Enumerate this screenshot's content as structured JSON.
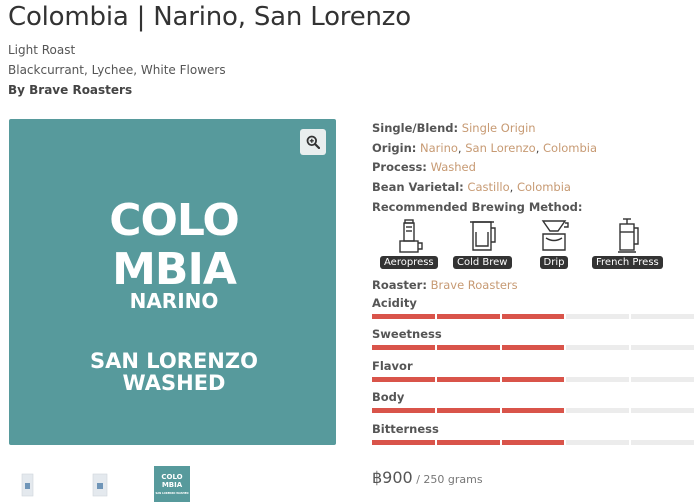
{
  "product": {
    "title": "Colombia | Narino, San Lorenzo",
    "roast": "Light Roast",
    "notes": "Blackcurrant, Lychee, White Flowers",
    "by": "By Brave Roasters"
  },
  "image": {
    "bag_lines": [
      "COLO",
      "MBIA",
      "NARINO",
      "SAN LORENZO",
      "WASHED"
    ],
    "thumb_lines": [
      "COLO",
      "MBIA",
      "SAN LORENZO WASHED"
    ]
  },
  "details": {
    "single_blend": {
      "label": "Single/Blend:",
      "value": "Single Origin"
    },
    "origin": {
      "label": "Origin:",
      "values": [
        "Narino",
        "San Lorenzo",
        "Colombia"
      ],
      "sep": ", "
    },
    "process": {
      "label": "Process:",
      "value": "Washed"
    },
    "varietal": {
      "label": "Bean Varietal:",
      "values": [
        "Castillo",
        "Colombia"
      ],
      "sep": ", "
    },
    "brewing_label": "Recommended Brewing Method:",
    "roaster": {
      "label": "Roaster:",
      "value": "Brave Roasters"
    }
  },
  "brew_methods": [
    {
      "label": "Aeropress",
      "icon": "aeropress-icon"
    },
    {
      "label": "Cold Brew",
      "icon": "cold-brew-icon"
    },
    {
      "label": "Drip",
      "icon": "drip-icon"
    },
    {
      "label": "French Press",
      "icon": "french-press-icon"
    }
  ],
  "attributes": [
    {
      "label": "Acidity",
      "level": 3,
      "max": 5
    },
    {
      "label": "Sweetness",
      "level": 3,
      "max": 5
    },
    {
      "label": "Flavor",
      "level": 3,
      "max": 5
    },
    {
      "label": "Body",
      "level": 3,
      "max": 5
    },
    {
      "label": "Bitterness",
      "level": 3,
      "max": 5
    }
  ],
  "price": {
    "amount": "฿900",
    "unit": " / 250 grams"
  },
  "colors": {
    "accent": "#c79a73",
    "bar_on": "#d9544a",
    "bar_off": "#ececec",
    "bag": "#579a9c"
  }
}
